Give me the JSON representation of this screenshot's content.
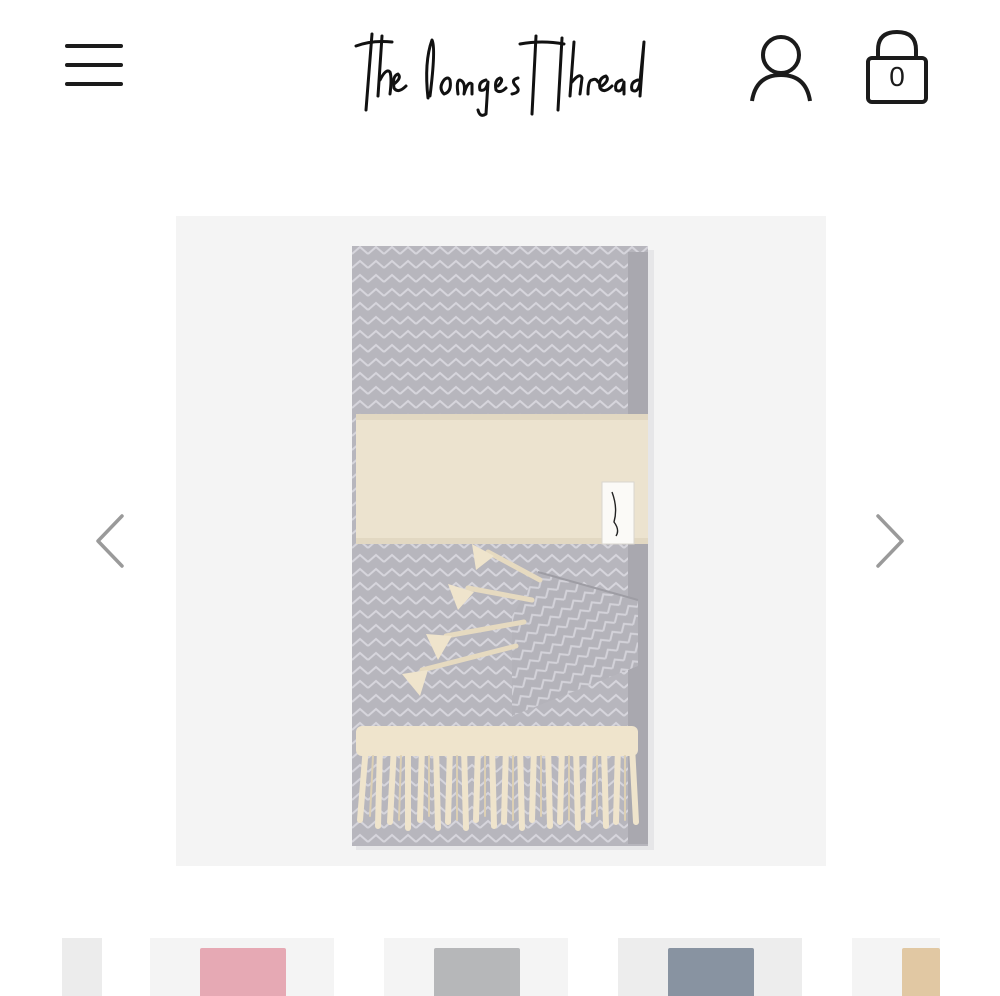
{
  "header": {
    "brand_name": "the longest thread",
    "cart_count": "0",
    "icons": {
      "menu": "hamburger-menu-icon",
      "account": "user-icon",
      "cart": "shopping-bag-icon"
    }
  },
  "product": {
    "image_subject": "folded herringbone towel with cream stripe and tassels",
    "colors": {
      "towel_grey": "#b7b6bd",
      "stripe_cream": "#ece3cf",
      "fringe": "#efe4cc",
      "image_background": "#f4f4f4"
    }
  },
  "carousel": {
    "prev_icon": "chevron-left-icon",
    "next_icon": "chevron-right-icon"
  },
  "thumbnails": [
    {
      "color": "#e8e8e8",
      "partial": true
    },
    {
      "color": "#e6a9b4"
    },
    {
      "color": "#b6b7b9"
    },
    {
      "color": "#8893a1"
    },
    {
      "color": "#e1c8a3",
      "partial": true
    }
  ]
}
